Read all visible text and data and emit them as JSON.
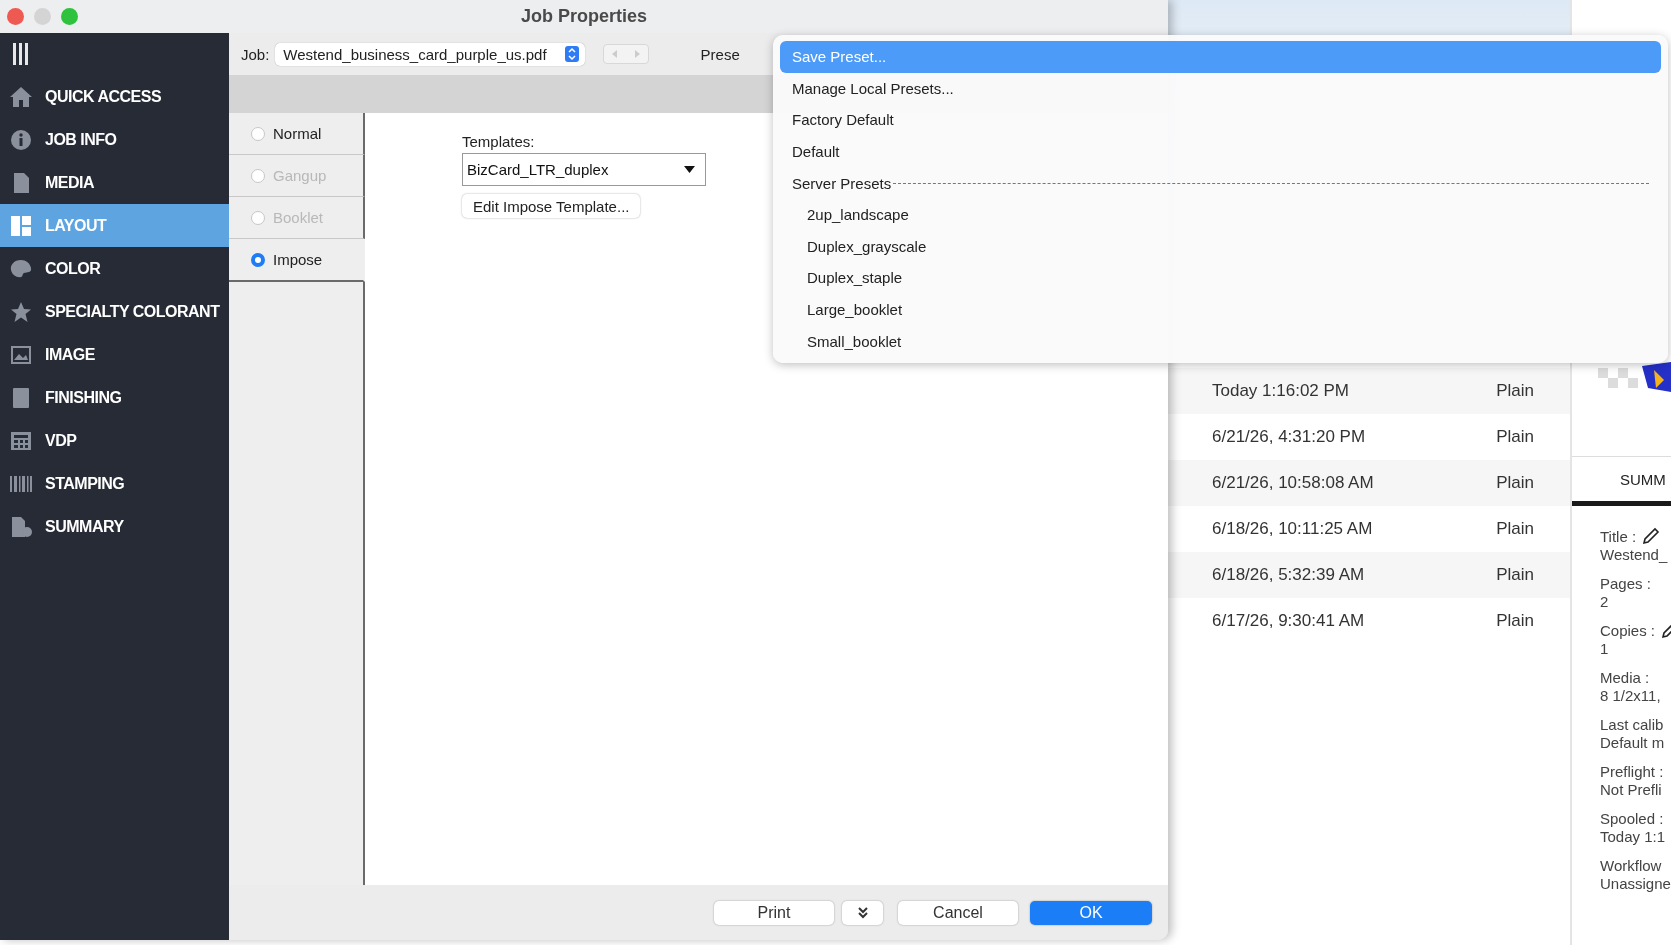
{
  "window": {
    "title": "Job Properties"
  },
  "sidebar": {
    "items": [
      {
        "label": "QUICK ACCESS",
        "selected": false
      },
      {
        "label": "JOB INFO",
        "selected": false
      },
      {
        "label": "MEDIA",
        "selected": false
      },
      {
        "label": "LAYOUT",
        "selected": true
      },
      {
        "label": "COLOR",
        "selected": false
      },
      {
        "label": "SPECIALTY COLORANT",
        "selected": false
      },
      {
        "label": "IMAGE",
        "selected": false
      },
      {
        "label": "FINISHING",
        "selected": false
      },
      {
        "label": "VDP",
        "selected": false
      },
      {
        "label": "STAMPING",
        "selected": false
      },
      {
        "label": "SUMMARY",
        "selected": false
      }
    ]
  },
  "job_bar": {
    "label": "Job:",
    "file": "Westend_business_card_purple_us.pdf",
    "preset_label": "Prese"
  },
  "layout_modes": [
    {
      "label": "Normal",
      "selected": false,
      "disabled": false
    },
    {
      "label": "Gangup",
      "selected": false,
      "disabled": true
    },
    {
      "label": "Booklet",
      "selected": false,
      "disabled": true
    },
    {
      "label": "Impose",
      "selected": true,
      "disabled": false
    }
  ],
  "templates": {
    "label": "Templates:",
    "value": "BizCard_LTR_duplex",
    "edit_button": "Edit Impose Template..."
  },
  "footer_buttons": [
    {
      "kind": "default",
      "label": "Print"
    },
    {
      "kind": "more"
    },
    {
      "kind": "default",
      "label": "Cancel"
    },
    {
      "kind": "primary",
      "label": "OK"
    }
  ],
  "preset_menu": {
    "items": [
      {
        "label": "Save Preset...",
        "selected": true
      },
      {
        "label": "Manage Local Presets...",
        "selected": false
      },
      {
        "label": "Factory Default",
        "selected": false
      },
      {
        "label": "Default",
        "selected": false
      },
      {
        "label": "Server Presets",
        "selected": false,
        "children": [
          {
            "label": "2up_landscape",
            "selected": false
          },
          {
            "label": "Duplex_grayscale",
            "selected": false
          },
          {
            "label": "Duplex_staple",
            "selected": false
          },
          {
            "label": "Large_booklet",
            "selected": false
          },
          {
            "label": "Small_booklet",
            "selected": false
          }
        ]
      }
    ]
  },
  "job_list": {
    "rows": [
      {
        "date": "Today 1:16:02 PM",
        "type": "Plain"
      },
      {
        "date": "6/21/26, 4:31:20 PM",
        "type": "Plain"
      },
      {
        "date": "6/21/26, 10:58:08 AM",
        "type": "Plain"
      },
      {
        "date": "6/18/26, 10:11:25 AM",
        "type": "Plain"
      },
      {
        "date": "6/18/26, 5:32:39 AM",
        "type": "Plain"
      },
      {
        "date": "6/17/26, 9:30:41 AM",
        "type": "Plain"
      }
    ]
  },
  "summary_panel": {
    "tab": "SUMM",
    "fields": [
      {
        "label": "Title :",
        "value": "Westend_",
        "editable": true
      },
      {
        "label": "Pages :",
        "value": "2",
        "editable": false
      },
      {
        "label": "Copies :",
        "value": "1",
        "editable": true
      },
      {
        "label": "Media :",
        "value": "8 1/2x11,",
        "editable": false
      },
      {
        "label": "Last calib",
        "value": "Default m",
        "editable": false
      },
      {
        "label": "Preflight :",
        "value": "Not Prefli",
        "editable": false
      },
      {
        "label": "Spooled :",
        "value": "Today 1:1",
        "editable": false
      },
      {
        "label": "Workflow",
        "value": "Unassigne",
        "editable": false
      }
    ]
  }
}
